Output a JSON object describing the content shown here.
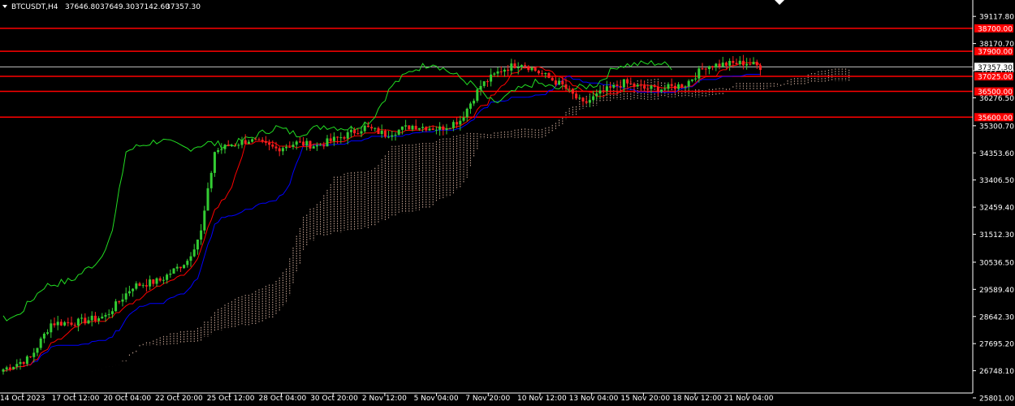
{
  "header": {
    "symbol": "BTCUSDT,H4",
    "open": "37646.80",
    "high": "37649.30",
    "low": "37142.60",
    "close": "37357.30"
  },
  "colors": {
    "background": "#000000",
    "bull": "#33cc33",
    "bear": "#ff2020",
    "tenkan": "#ff0000",
    "kijun": "#0000ff",
    "chikou": "#22dd22",
    "kumo": "#f2c9b5",
    "level": "#ff0000",
    "price_line": "#dddddd"
  },
  "chart_data": {
    "type": "candlestick",
    "ylim": [
      25801.0,
      39520.0
    ],
    "y_ticks": [
      "39117.80",
      "38170.70",
      "37223.60",
      "36276.50",
      "35300.70",
      "34353.60",
      "33406.50",
      "32459.40",
      "31512.30",
      "30536.50",
      "29589.40",
      "28642.30",
      "27695.20",
      "26748.10",
      "25801.00"
    ],
    "x_labels": [
      "14 Oct 2023",
      "17 Oct 12:00",
      "20 Oct 04:00",
      "22 Oct 20:00",
      "25 Oct 12:00",
      "28 Oct 04:00",
      "30 Oct 20:00",
      "2 Nov 12:00",
      "5 Nov 04:00",
      "7 Nov 20:00",
      "10 Nov 12:00",
      "13 Nov 04:00",
      "15 Nov 20:00",
      "18 Nov 12:00",
      "21 Nov 04:00"
    ],
    "levels": [
      {
        "value": 38700.0,
        "label": "38700.00"
      },
      {
        "value": 37900.0,
        "label": "37900.00"
      },
      {
        "value": 37025.0,
        "label": "37025.00"
      },
      {
        "value": 36500.0,
        "label": "36500.00"
      },
      {
        "value": 35600.0,
        "label": "35600.00"
      }
    ],
    "current_price": {
      "value": 37357.3,
      "label": "37357.30"
    },
    "anchors": [
      [
        0,
        26800
      ],
      [
        8,
        27200
      ],
      [
        14,
        28400
      ],
      [
        22,
        28450
      ],
      [
        30,
        28650
      ],
      [
        38,
        29700
      ],
      [
        46,
        29900
      ],
      [
        54,
        30600
      ],
      [
        58,
        31600
      ],
      [
        62,
        34400
      ],
      [
        66,
        34600
      ],
      [
        72,
        34800
      ],
      [
        80,
        34500
      ],
      [
        86,
        34700
      ],
      [
        92,
        34600
      ],
      [
        100,
        34950
      ],
      [
        106,
        35250
      ],
      [
        112,
        35000
      ],
      [
        120,
        35300
      ],
      [
        128,
        35200
      ],
      [
        134,
        35500
      ],
      [
        140,
        36700
      ],
      [
        146,
        37250
      ],
      [
        152,
        37500
      ],
      [
        158,
        37100
      ],
      [
        164,
        36700
      ],
      [
        170,
        36050
      ],
      [
        176,
        36500
      ],
      [
        182,
        36800
      ],
      [
        188,
        36600
      ],
      [
        194,
        36600
      ],
      [
        200,
        36750
      ],
      [
        206,
        37400
      ],
      [
        212,
        37450
      ],
      [
        218,
        37500
      ],
      [
        222,
        37357
      ]
    ],
    "series": [
      "Tenkan-sen",
      "Kijun-sen",
      "Chikou Span",
      "Senkou Span A",
      "Senkou Span B"
    ]
  }
}
